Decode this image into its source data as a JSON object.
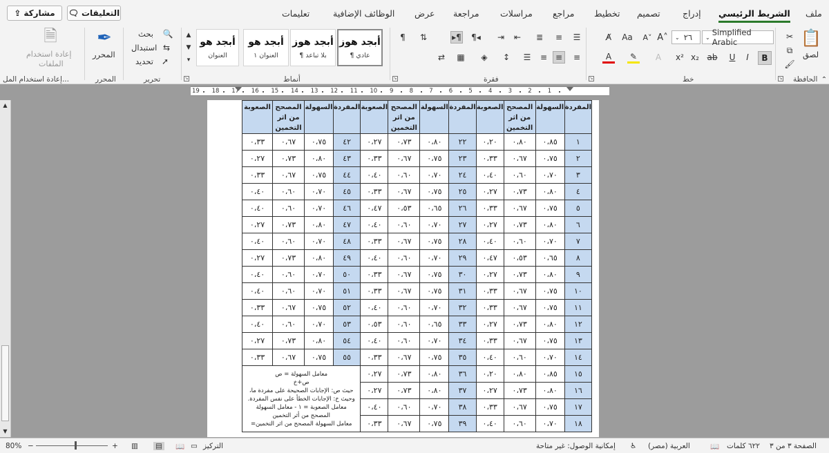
{
  "tabs": [
    {
      "label": "ملف",
      "active": false
    },
    {
      "label": "الشريط الرئيسي",
      "active": true
    },
    {
      "label": "إدراج",
      "active": false
    },
    {
      "label": "تصميم",
      "active": false
    },
    {
      "label": "تخطيط",
      "active": false
    },
    {
      "label": "مراجع",
      "active": false
    },
    {
      "label": "مراسلات",
      "active": false
    },
    {
      "label": "مراجعة",
      "active": false
    },
    {
      "label": "عرض",
      "active": false
    },
    {
      "label": "الوظائف الإضافية",
      "active": false
    },
    {
      "label": "تعليمات",
      "active": false
    }
  ],
  "top_buttons": {
    "comments": "التعليقات",
    "share": "مشاركة"
  },
  "ribbon": {
    "clipboard": {
      "paste": "لصق",
      "group": "الحافظة"
    },
    "font": {
      "name": "Simplified Arabic",
      "size": "٢٦",
      "group": "خط",
      "grow": "A",
      "shrink": "A",
      "case": "Aa"
    },
    "paragraph": {
      "group": "فقرة"
    },
    "styles": {
      "group": "أنماط",
      "items": [
        {
          "preview": "أبجد هوز",
          "name": "¶ عادي",
          "active": true
        },
        {
          "preview": "أبجد هوز",
          "name": "¶ بلا تباعد",
          "active": false
        },
        {
          "preview": "أبجد هو",
          "name": "العنوان ١",
          "active": false
        },
        {
          "preview": "أبجد هو",
          "name": "العنوان",
          "active": false
        }
      ]
    },
    "editing": {
      "find": "بحث",
      "replace": "استبدال",
      "select": "تحديد",
      "group": "تحرير"
    },
    "editor": {
      "label": "المحرر",
      "group": "المحرر"
    },
    "reuse": {
      "label_line1": "إعادة استخدام",
      "label_line2": "الملفات",
      "group": "إعادة استخدام المل..."
    }
  },
  "ruler": {
    "numbers": [
      "19",
      "18",
      "17",
      "16",
      "15",
      "14",
      "13",
      "12",
      "11",
      "10",
      "9",
      "8",
      "7",
      "6",
      "5",
      "4",
      "3",
      "2",
      "1"
    ]
  },
  "table": {
    "headers": [
      "المفردة",
      "السهولة",
      "المصحح من اثر التخمين",
      "الصعوبة",
      "المفردة",
      "السهولة",
      "المصحح من اثر التخمين",
      "الصعوبة",
      "المفردة",
      "السهولة",
      "المصحح من اثر التخمين",
      "الصعوبة"
    ],
    "rows": [
      [
        "١",
        "٠،٨٥",
        "٠،٨٠",
        "٠،٢٠",
        "٢٢",
        "٠،٨٠",
        "٠،٧٣",
        "٠،٢٧",
        "٤٢",
        "٠،٧٥",
        "٠،٦٧",
        "٠،٣٣"
      ],
      [
        "٢",
        "٠،٧٥",
        "٠،٦٧",
        "٠،٣٣",
        "٢٣",
        "٠،٧٥",
        "٠،٦٧",
        "٠،٣٣",
        "٤٣",
        "٠،٨٠",
        "٠،٧٣",
        "٠،٢٧"
      ],
      [
        "٣",
        "٠،٧٠",
        "٠،٦٠",
        "٠،٤٠",
        "٢٤",
        "٠،٧٠",
        "٠،٦٠",
        "٠،٤٠",
        "٤٤",
        "٠،٧٥",
        "٠،٦٧",
        "٠،٣٣"
      ],
      [
        "٤",
        "٠،٨٠",
        "٠،٧٣",
        "٠،٢٧",
        "٢٥",
        "٠،٧٥",
        "٠،٦٧",
        "٠،٣٣",
        "٤٥",
        "٠،٧٠",
        "٠،٦٠",
        "٠،٤٠"
      ],
      [
        "٥",
        "٠،٧٥",
        "٠،٦٧",
        "٠،٣٣",
        "٢٦",
        "٠،٦٥",
        "٠،٥٣",
        "٠،٤٧",
        "٤٦",
        "٠،٧٠",
        "٠،٦٠",
        "٠،٤٠"
      ],
      [
        "٦",
        "٠،٨٠",
        "٠،٧٣",
        "٠،٢٧",
        "٢٧",
        "٠،٧٠",
        "٠،٦٠",
        "٠،٤٠",
        "٤٧",
        "٠،٨٠",
        "٠،٧٣",
        "٠،٢٧"
      ],
      [
        "٧",
        "٠،٧٠",
        "٠،٦٠",
        "٠،٤٠",
        "٢٨",
        "٠،٧٥",
        "٠،٦٧",
        "٠،٣٣",
        "٤٨",
        "٠،٧٠",
        "٠،٦٠",
        "٠،٤٠"
      ],
      [
        "٨",
        "٠،٦٥",
        "٠،٥٣",
        "٠،٤٧",
        "٢٩",
        "٠،٧٠",
        "٠،٦٠",
        "٠،٤٠",
        "٤٩",
        "٠،٨٠",
        "٠،٧٣",
        "٠،٢٧"
      ],
      [
        "٩",
        "٠،٨٠",
        "٠،٧٣",
        "٠،٢٧",
        "٣٠",
        "٠،٧٥",
        "٠،٦٧",
        "٠،٣٣",
        "٥٠",
        "٠،٧٠",
        "٠،٦٠",
        "٠،٤٠"
      ],
      [
        "١٠",
        "٠،٧٥",
        "٠،٦٧",
        "٠،٣٣",
        "٣١",
        "٠،٧٥",
        "٠،٦٧",
        "٠،٣٣",
        "٥١",
        "٠،٧٠",
        "٠،٦٠",
        "٠،٤٠"
      ],
      [
        "١١",
        "٠،٧٥",
        "٠،٦٧",
        "٠،٣٣",
        "٣٢",
        "٠،٧٠",
        "٠،٦٠",
        "٠،٤٠",
        "٥٢",
        "٠،٧٥",
        "٠،٦٧",
        "٠،٣٣"
      ],
      [
        "١٢",
        "٠،٨٠",
        "٠،٧٣",
        "٠،٢٧",
        "٣٣",
        "٠،٦٥",
        "٠،٦٠",
        "٠،٥٣",
        "٥٣",
        "٠،٧٠",
        "٠،٦٠",
        "٠،٤٠"
      ],
      [
        "١٣",
        "٠،٧٥",
        "٠،٦٧",
        "٠،٣٣",
        "٣٤",
        "٠،٧٠",
        "٠،٦٠",
        "٠،٤٠",
        "٥٤",
        "٠،٨٠",
        "٠،٧٣",
        "٠،٢٧"
      ],
      [
        "١٤",
        "٠،٧٠",
        "٠،٦٠",
        "٠،٤٠",
        "٣٥",
        "٠،٧٥",
        "٠،٦٧",
        "٠،٣٣",
        "٥٥",
        "٠،٧٥",
        "٠،٦٧",
        "٠،٣٣"
      ],
      [
        "١٥",
        "٠،٨٥",
        "٠،٨٠",
        "٠،٢٠",
        "٣٦",
        "٠،٨٠",
        "٠،٧٣",
        "٠،٢٧"
      ],
      [
        "١٦",
        "٠،٨٠",
        "٠،٧٣",
        "٠،٢٧",
        "٣٧",
        "٠،٨٠",
        "٠،٧٣",
        "٠،٢٧"
      ],
      [
        "١٧",
        "٠،٧٥",
        "٠،٦٧",
        "٠،٣٣",
        "٣٨",
        "٠،٧٠",
        "٠،٦٠",
        "٠،٤٠"
      ],
      [
        "١٨",
        "٠،٧٠",
        "٠،٦٠",
        "٠،٤٠",
        "٣٩",
        "٠،٧٥",
        "٠،٦٧",
        "٠،٣٣"
      ]
    ],
    "note": {
      "line1": "معامل السهولة = ص",
      "line2": "ص+خ",
      "line3": "حيث ص: الإجابات الصحيحة على مفردة ما،",
      "line4": "وحيث خ: الإجابات الخطأ على نفس المفردة.",
      "line5": "معامل الصعوبة = ١ - معامل السهولة المصحح من أثر التخمين",
      "line6": "معامل السهولة المصحح من اثر التخمين="
    }
  },
  "statusbar": {
    "page": "الصفحة ٣ من ٣",
    "words": "٦٢٢ كلمات",
    "language": "العربية (مصر)",
    "accessibility": "إمكانية الوصول: غير متاحة",
    "focus": "التركيز",
    "zoom": "80%"
  },
  "colors": {
    "accent": "#2b7a2b",
    "table_header": "#c5d9f0",
    "canvas": "#9c9c9c"
  }
}
